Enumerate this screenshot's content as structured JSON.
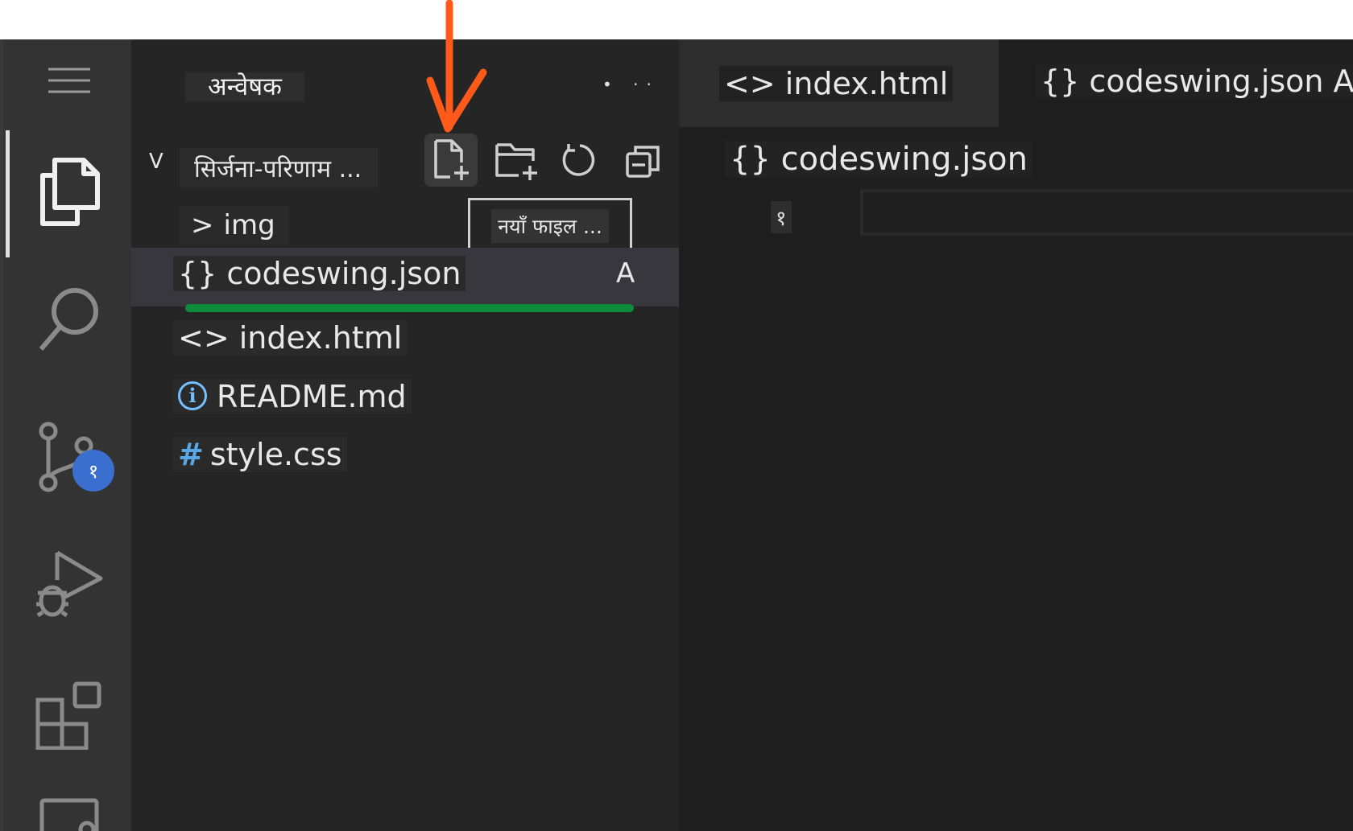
{
  "sidebar": {
    "title": "अन्वेषक",
    "more_actions": "• ··",
    "folder": {
      "chevron": "V",
      "name": "सिर्जना-परिणाम ..."
    },
    "tooltip": "नयाँ फाइल ...",
    "items": [
      {
        "icon": ">",
        "label": "img"
      },
      {
        "icon": "{}",
        "label": "codeswing.json",
        "status": "A"
      },
      {
        "icon": "<>",
        "label": "index.html"
      },
      {
        "icon": "i",
        "label": "README.md"
      },
      {
        "icon": "#",
        "label": "style.css"
      }
    ]
  },
  "activity_bar": {
    "scm_badge": "१"
  },
  "editor": {
    "tabs": [
      {
        "label": "<> index.html"
      },
      {
        "label": "{} codeswing.json A"
      }
    ],
    "breadcrumb": "{} codeswing.json",
    "line_number": "१"
  },
  "colors": {
    "annotation_arrow": "#ff5a1a",
    "underline": "#0e8c3c",
    "badge": "#3a6fd0",
    "css_hash": "#5aa7e6"
  },
  "icons": [
    "menu-icon",
    "explorer-icon",
    "search-icon",
    "source-control-icon",
    "run-debug-icon",
    "extensions-icon",
    "remote-icon",
    "new-file-icon",
    "new-folder-icon",
    "refresh-icon",
    "collapse-all-icon",
    "info-icon"
  ]
}
